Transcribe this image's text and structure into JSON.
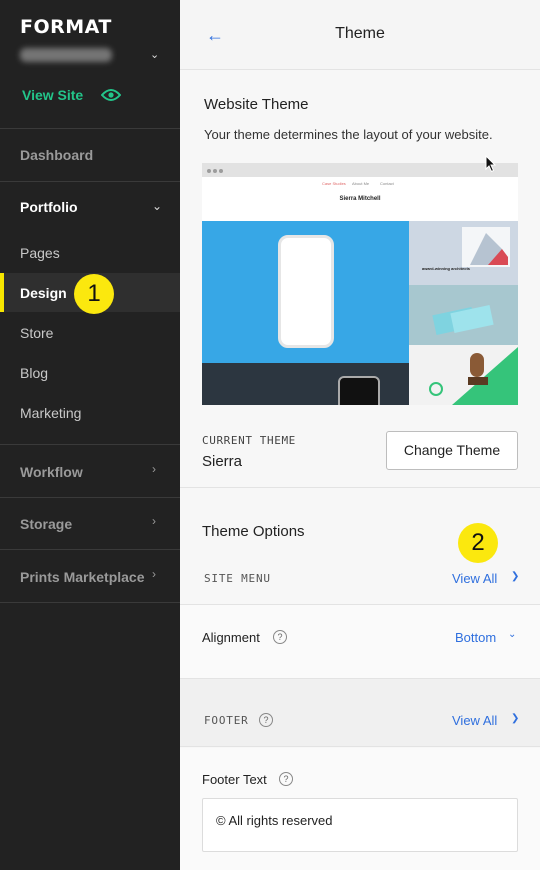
{
  "brand": {
    "logo": "FORMAT"
  },
  "sidebar": {
    "view_site": "View Site",
    "items": [
      {
        "label": "Dashboard"
      },
      {
        "label": "Portfolio"
      },
      {
        "label": "Pages"
      },
      {
        "label": "Design"
      },
      {
        "label": "Store"
      },
      {
        "label": "Blog"
      },
      {
        "label": "Marketing"
      },
      {
        "label": "Workflow"
      },
      {
        "label": "Storage"
      },
      {
        "label": "Prints Marketplace"
      }
    ],
    "active_item": "Design"
  },
  "callouts": {
    "one": "1",
    "two": "2"
  },
  "header": {
    "title": "Theme"
  },
  "website_theme": {
    "heading": "Website Theme",
    "description": "Your theme determines the layout of your website.",
    "preview": {
      "nav": [
        "Case Studies",
        "About Me",
        "Contact"
      ],
      "site_name": "Sierra Mitchell",
      "caption": "award-winning architects"
    }
  },
  "current_theme": {
    "label": "CURRENT THEME",
    "value": "Sierra",
    "change_button": "Change Theme"
  },
  "theme_options": {
    "heading": "Theme Options",
    "site_menu": {
      "label": "SITE MENU",
      "link": "View All"
    },
    "alignment": {
      "label": "Alignment",
      "value": "Bottom"
    },
    "footer": {
      "label": "FOOTER",
      "link": "View All"
    },
    "footer_text": {
      "label": "Footer Text",
      "value": "© All rights reserved"
    }
  },
  "colors": {
    "sidebar_bg": "#222222",
    "accent_green": "#23c58a",
    "accent_blue": "#2f6fde",
    "active_marker": "#f7e600",
    "callout_yellow": "#fbe80e"
  },
  "icons": [
    "eye-icon",
    "chevron-down-icon",
    "chevron-right-icon",
    "back-arrow-icon",
    "help-icon",
    "cursor-icon"
  ]
}
